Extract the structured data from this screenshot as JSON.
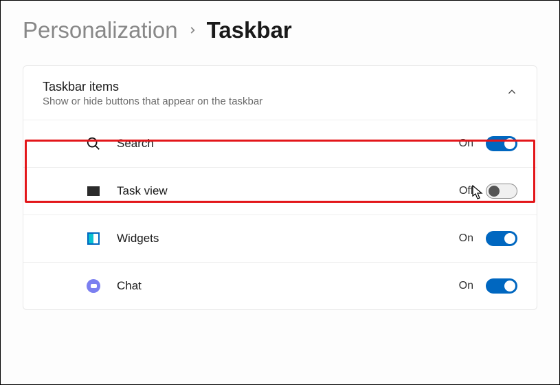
{
  "breadcrumb": {
    "parent": "Personalization",
    "current": "Taskbar"
  },
  "section": {
    "title": "Taskbar items",
    "subtitle": "Show or hide buttons that appear on the taskbar"
  },
  "items": [
    {
      "icon": "search-icon",
      "label": "Search",
      "state": "On",
      "on": true
    },
    {
      "icon": "taskview-icon",
      "label": "Task view",
      "state": "Off",
      "on": false
    },
    {
      "icon": "widgets-icon",
      "label": "Widgets",
      "state": "On",
      "on": true
    },
    {
      "icon": "chat-icon",
      "label": "Chat",
      "state": "On",
      "on": true
    }
  ]
}
